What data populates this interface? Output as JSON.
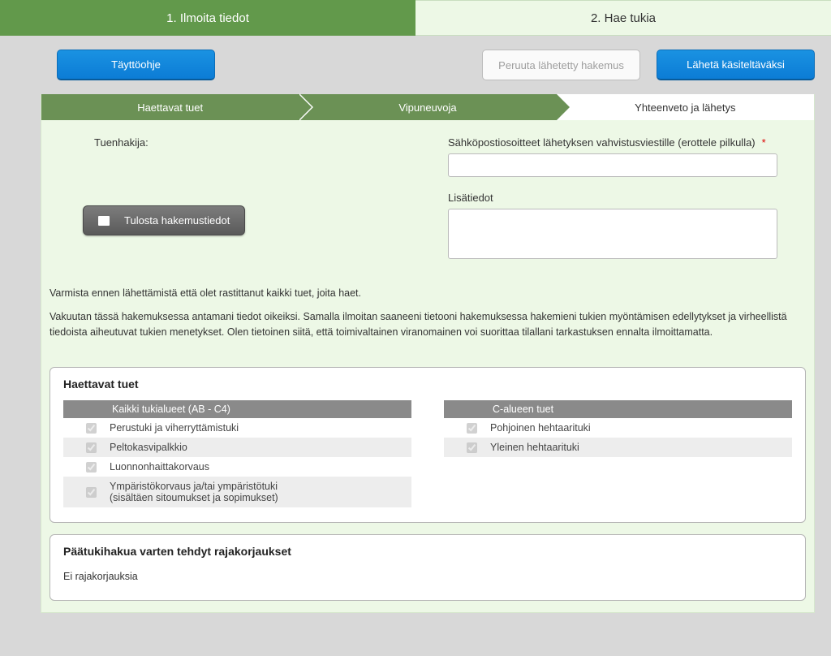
{
  "pageTabs": {
    "tab1": "1. Ilmoita tiedot",
    "tab2": "2. Hae tukia"
  },
  "toolbar": {
    "help": "Täyttöohje",
    "cancel": "Peruuta lähetetty hakemus",
    "submit": "Lähetä käsiteltäväksi"
  },
  "stepper": {
    "s1": "Haettavat tuet",
    "s2": "Vipuneuvoja",
    "s3": "Yhteenveto ja lähetys"
  },
  "form": {
    "applicantLabel": "Tuenhakija:",
    "printButton": "Tulosta hakemustiedot",
    "emailLabel": "Sähköpostiosoitteet lähetyksen vahvistusviestille (erottele pilkulla)",
    "emailValue": "",
    "notesLabel": "Lisätiedot",
    "notesValue": ""
  },
  "disclaimer": {
    "p1": "Varmista ennen lähettämistä että olet rastittanut kaikki tuet, joita haet.",
    "p2": "Vakuutan tässä hakemuksessa antamani tiedot oikeiksi. Samalla ilmoitan saaneeni tietooni hakemuksessa hakemieni tukien myöntämisen edellytykset ja virheellistä tiedoista aiheutuvat tukien menetykset. Olen tietoinen siitä, että toimivaltainen viranomainen voi suorittaa tilallani tarkastuksen ennalta ilmoittamatta."
  },
  "supportsPanel": {
    "title": "Haettavat tuet",
    "leftHeader": "Kaikki tukialueet (AB - C4)",
    "leftItems": [
      "Perustuki ja viherryttämistuki",
      "Peltokasvipalkkio",
      "Luonnonhaittakorvaus",
      "Ympäristökorvaus ja/tai ympäristötuki\n(sisältäen sitoumukset ja sopimukset)"
    ],
    "rightHeader": "C-alueen tuet",
    "rightItems": [
      "Pohjoinen hehtaarituki",
      "Yleinen hehtaarituki"
    ]
  },
  "boundaryPanel": {
    "title": "Päätukihakua varten tehdyt rajakorjaukset",
    "text": "Ei rajakorjauksia"
  }
}
